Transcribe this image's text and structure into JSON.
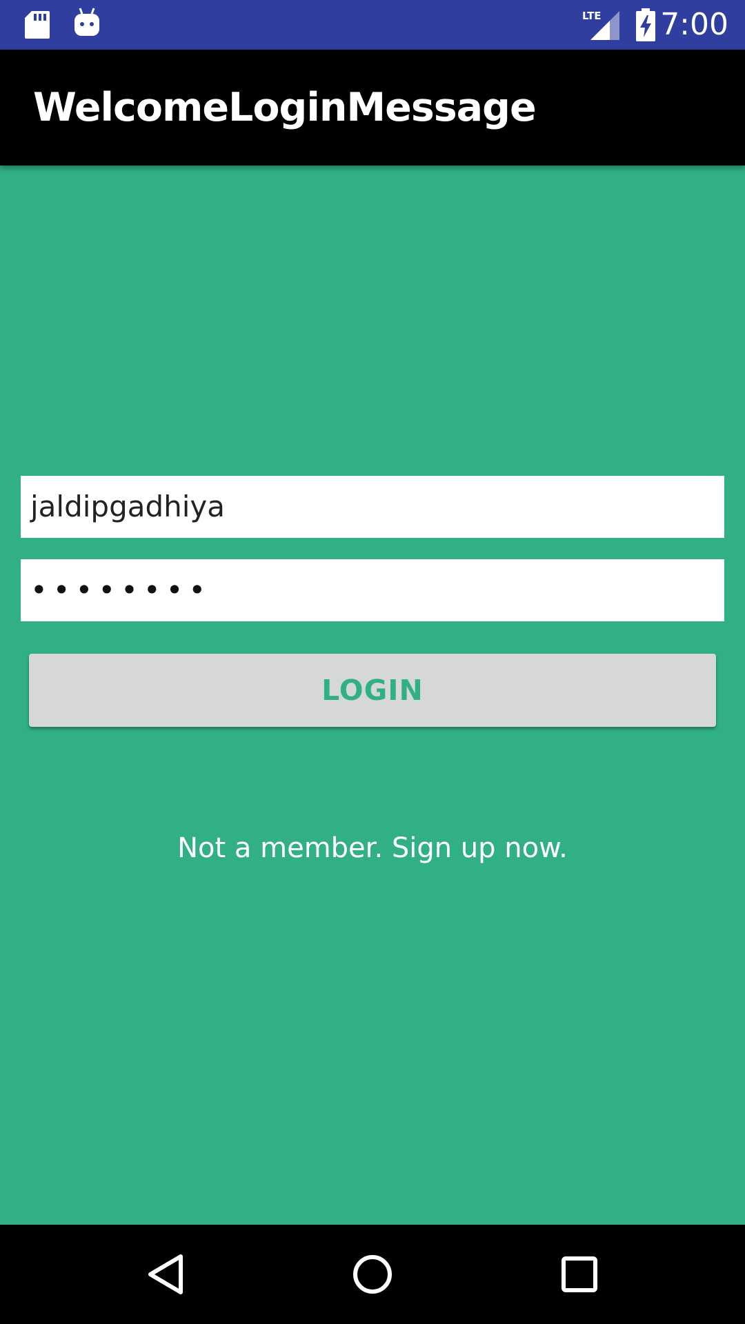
{
  "status_bar": {
    "time": "7:00",
    "network_label": "LTE",
    "icons": [
      "sd-card-icon",
      "android-icon",
      "lte-signal-icon",
      "battery-charging-icon"
    ],
    "background_color": "#303f9f"
  },
  "app_bar": {
    "title": "WelcomeLoginMessage",
    "background_color": "#000000"
  },
  "form": {
    "username_value": "jaldipgadhiya",
    "password_masked": "••••••••",
    "login_label": "LOGIN",
    "signup_text": "Not a member. Sign up now."
  },
  "theme": {
    "background_color": "#31b086",
    "button_color": "#d6d7d7",
    "button_text_color": "#31b086"
  },
  "nav_bar": {
    "buttons": [
      "back-icon",
      "home-icon",
      "recent-apps-icon"
    ]
  }
}
